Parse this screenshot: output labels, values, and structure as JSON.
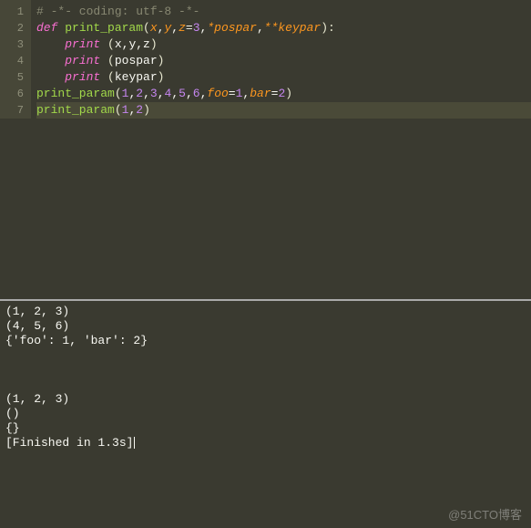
{
  "editor": {
    "gutter": [
      "1",
      "2",
      "3",
      "4",
      "5",
      "6",
      "7"
    ],
    "lines": [
      {
        "segments": [
          {
            "cls": "comment",
            "t": "# -*- coding: utf-8 -*-"
          }
        ]
      },
      {
        "segments": [
          {
            "cls": "keyword",
            "t": "def "
          },
          {
            "cls": "func",
            "t": "print_param"
          },
          {
            "cls": "paren",
            "t": "("
          },
          {
            "cls": "param",
            "t": "x"
          },
          {
            "cls": "plain",
            "t": ","
          },
          {
            "cls": "param",
            "t": "y"
          },
          {
            "cls": "plain",
            "t": ","
          },
          {
            "cls": "param",
            "t": "z"
          },
          {
            "cls": "plain",
            "t": "="
          },
          {
            "cls": "num",
            "t": "3"
          },
          {
            "cls": "plain",
            "t": ","
          },
          {
            "cls": "param",
            "t": "*pospar"
          },
          {
            "cls": "plain",
            "t": ","
          },
          {
            "cls": "param",
            "t": "**keypar"
          },
          {
            "cls": "paren",
            "t": "):"
          }
        ]
      },
      {
        "segments": [
          {
            "cls": "plain",
            "t": "    "
          },
          {
            "cls": "keyword",
            "t": "print "
          },
          {
            "cls": "paren",
            "t": "("
          },
          {
            "cls": "plain",
            "t": "x,y,z"
          },
          {
            "cls": "paren",
            "t": ")"
          }
        ]
      },
      {
        "segments": [
          {
            "cls": "plain",
            "t": "    "
          },
          {
            "cls": "keyword",
            "t": "print "
          },
          {
            "cls": "paren",
            "t": "("
          },
          {
            "cls": "plain",
            "t": "pospar"
          },
          {
            "cls": "paren",
            "t": ")"
          }
        ]
      },
      {
        "segments": [
          {
            "cls": "plain",
            "t": "    "
          },
          {
            "cls": "keyword",
            "t": "print "
          },
          {
            "cls": "paren",
            "t": "("
          },
          {
            "cls": "plain",
            "t": "keypar"
          },
          {
            "cls": "paren",
            "t": ")"
          }
        ]
      },
      {
        "segments": [
          {
            "cls": "func",
            "t": "print_param"
          },
          {
            "cls": "paren",
            "t": "("
          },
          {
            "cls": "num",
            "t": "1"
          },
          {
            "cls": "plain",
            "t": ","
          },
          {
            "cls": "num",
            "t": "2"
          },
          {
            "cls": "plain",
            "t": ","
          },
          {
            "cls": "num",
            "t": "3"
          },
          {
            "cls": "plain",
            "t": ","
          },
          {
            "cls": "num",
            "t": "4"
          },
          {
            "cls": "plain",
            "t": ","
          },
          {
            "cls": "num",
            "t": "5"
          },
          {
            "cls": "plain",
            "t": ","
          },
          {
            "cls": "num",
            "t": "6"
          },
          {
            "cls": "plain",
            "t": ","
          },
          {
            "cls": "kwarg",
            "t": "foo"
          },
          {
            "cls": "plain",
            "t": "="
          },
          {
            "cls": "num",
            "t": "1"
          },
          {
            "cls": "plain",
            "t": ","
          },
          {
            "cls": "kwarg",
            "t": "bar"
          },
          {
            "cls": "plain",
            "t": "="
          },
          {
            "cls": "num",
            "t": "2"
          },
          {
            "cls": "paren",
            "t": ")"
          }
        ]
      },
      {
        "hl": true,
        "segments": [
          {
            "cls": "func",
            "t": "print_param"
          },
          {
            "cls": "paren",
            "t": "("
          },
          {
            "cls": "num",
            "t": "1"
          },
          {
            "cls": "plain",
            "t": ","
          },
          {
            "cls": "num",
            "t": "2"
          },
          {
            "cls": "paren",
            "t": ")"
          }
        ]
      }
    ]
  },
  "output": {
    "lines": [
      "(1, 2, 3)",
      "(4, 5, 6)",
      "{'foo': 1, 'bar': 2}",
      "",
      "",
      "",
      "(1, 2, 3)",
      "()",
      "{}",
      "[Finished in 1.3s]"
    ]
  },
  "watermark": "@51CTO博客"
}
